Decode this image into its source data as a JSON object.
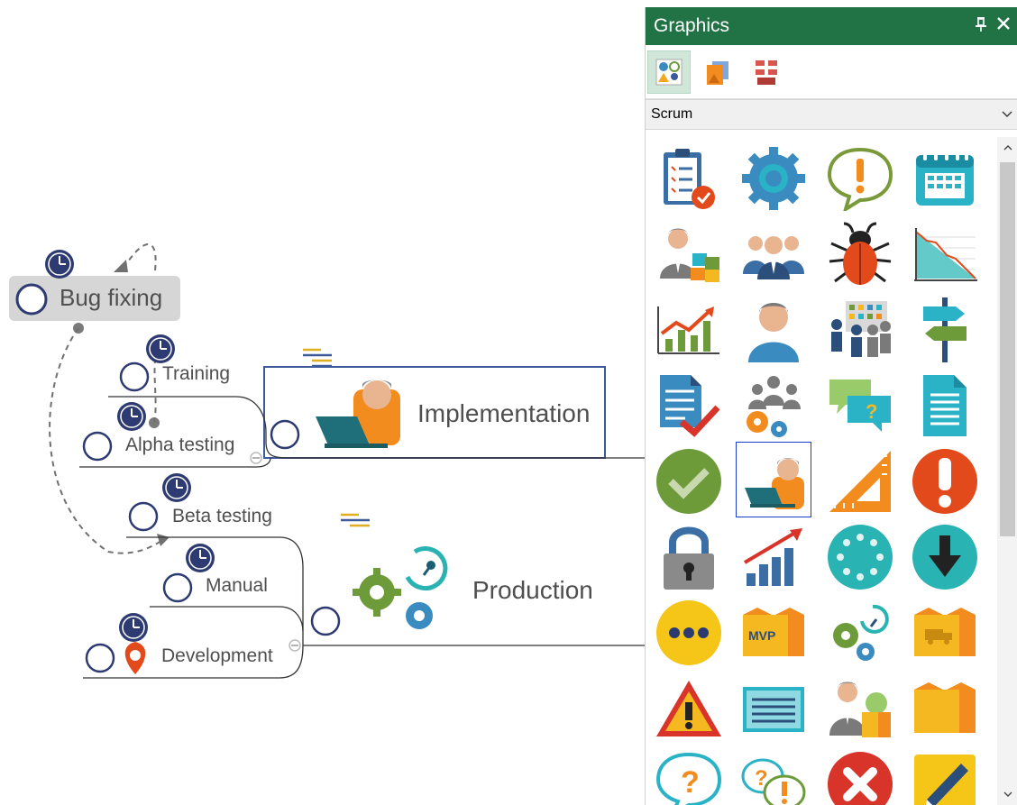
{
  "canvas": {
    "root": {
      "label": "Bug fixing"
    },
    "branches": [
      {
        "label": "Training"
      },
      {
        "label": "Alpha testing"
      },
      {
        "label": "Beta testing"
      },
      {
        "label": "Manual"
      },
      {
        "label": "Development"
      }
    ],
    "main_topics": [
      {
        "label": "Implementation"
      },
      {
        "label": "Production"
      }
    ]
  },
  "panel": {
    "title": "Graphics",
    "pin_icon": "pin-icon",
    "close_icon": "close-icon",
    "toolbar": [
      "scrum-graphics-tab",
      "image-library-tab",
      "shapes-tab"
    ],
    "category": "Scrum",
    "graphics": [
      [
        "clipboard-checklist-icon",
        "gear-icon",
        "exclamation-speech-icon",
        "calendar-icon"
      ],
      [
        "product-owner-cubes-icon",
        "team-icon",
        "bug-icon",
        "burndown-chart-icon"
      ],
      [
        "growth-chart-icon",
        "user-icon",
        "team-board-icon",
        "signpost-icon"
      ],
      [
        "document-check-icon",
        "team-gears-icon",
        "question-chat-icon",
        "document-icon"
      ],
      [
        "checkmark-circle-icon",
        "developer-laptop-icon",
        "triangle-ruler-icon",
        "alert-circle-icon"
      ],
      [
        "padlock-icon",
        "rising-bars-icon",
        "loading-dots-circle-icon",
        "download-arrow-icon"
      ],
      [
        "more-dots-icon",
        "mvp-box-icon",
        "gears-clock-icon",
        "delivery-box-icon"
      ],
      [
        "warning-triangle-icon",
        "text-card-icon",
        "user-package-icon",
        "open-box-icon"
      ],
      [
        "question-bubble-icon",
        "question-exclamation-bubbles-icon",
        "error-x-icon",
        "pen-paper-icon"
      ]
    ],
    "selected": "developer-laptop-icon",
    "colors": {
      "header": "#217346",
      "accent_blue": "#1a3fcf",
      "node_clock": "#2d3b72"
    }
  }
}
